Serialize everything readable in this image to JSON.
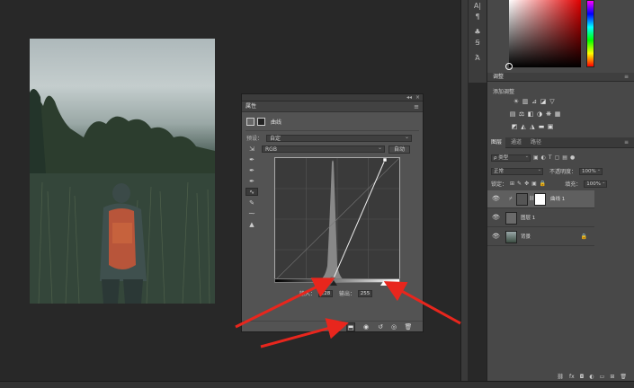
{
  "properties": {
    "title": "属性",
    "adjustment_name": "曲线",
    "preset_label": "预设：",
    "preset_value": "自定",
    "channel_value": "RGB",
    "auto_label": "自动",
    "input_label": "输入：",
    "input_value": "228",
    "output_label": "输出：",
    "output_value": "255",
    "tools": [
      "curve-edit-icon",
      "sample-black-icon",
      "sample-gray-icon",
      "sample-white-icon",
      "curve-points-icon",
      "pencil-icon",
      "smooth-icon",
      "clipping-warning-icon"
    ]
  },
  "adjustments": {
    "tab": "调整",
    "add_label": "添加调整",
    "row1_icons": [
      "brightness-icon",
      "levels-icon",
      "curves-icon",
      "exposure-icon",
      "vibrance-icon"
    ],
    "row2_icons": [
      "hue-sat-icon",
      "color-balance-icon",
      "black-white-icon",
      "photo-filter-icon",
      "channel-mixer-icon",
      "color-lookup-icon"
    ],
    "row3_icons": [
      "invert-icon",
      "posterize-icon",
      "threshold-icon",
      "gradient-map-icon",
      "selective-color-icon"
    ]
  },
  "layers": {
    "tabs": [
      "图层",
      "通道",
      "路径"
    ],
    "filter_kind": "ρ 类型",
    "blend_mode": "正常",
    "opacity_label": "不透明度：",
    "opacity_value": "100%",
    "lock_label": "锁定：",
    "fill_label": "填充：",
    "fill_value": "100%",
    "items": [
      {
        "name": "曲线 1",
        "selected": true
      },
      {
        "name": "图层 1",
        "selected": false
      },
      {
        "name": "背景",
        "selected": false
      }
    ],
    "footer_icons": [
      "link-icon",
      "fx-icon",
      "mask-icon",
      "adjustment-icon",
      "folder-icon",
      "new-layer-icon",
      "trash-icon"
    ]
  },
  "colors": {
    "accent_arrow": "#e8261d",
    "panel_bg": "#535353",
    "app_bg": "#282828"
  }
}
